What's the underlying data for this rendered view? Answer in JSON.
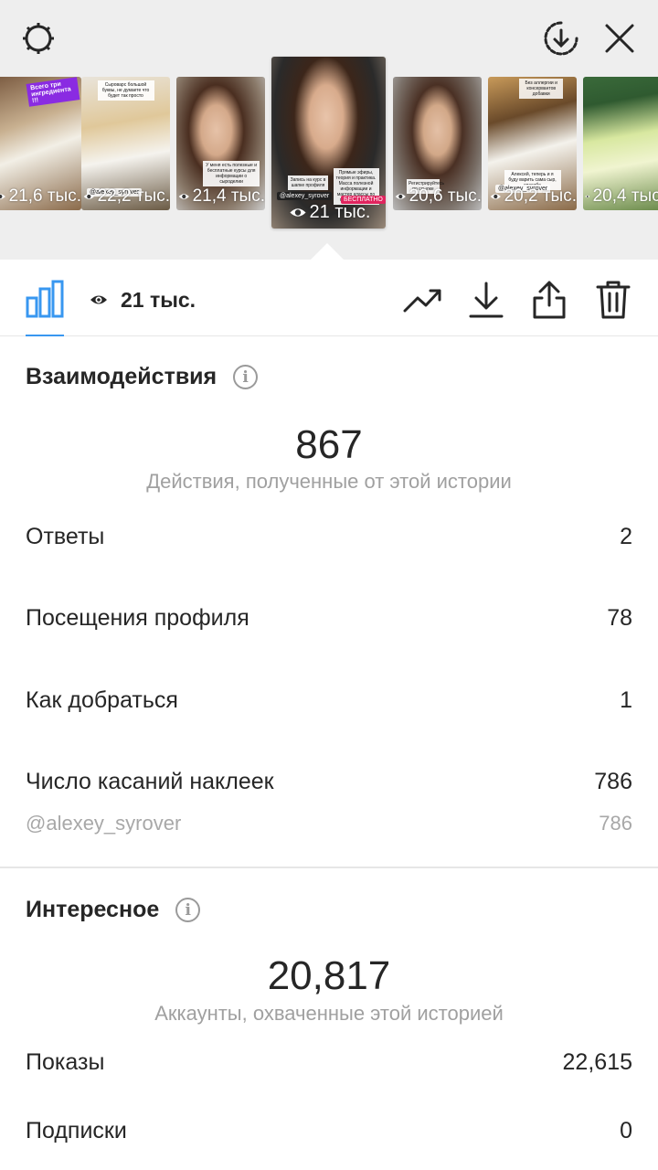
{
  "stories": [
    {
      "views": "21,6 тыс.",
      "caption": "Всего три ингредиента !!!"
    },
    {
      "views": "22,2 тыс.",
      "caption": "Сыроварс большой буквы, не думаете что будет так просто",
      "handle": "@alexey_syrover"
    },
    {
      "views": "21,4 тыс.",
      "caption": "У меня есть полезные и бесплатные курсы для информации о сыроделии"
    },
    {
      "views": "21 тыс.",
      "caption": "Запись на курс в шапке профиля",
      "handle": "@alexey_syrover",
      "caption2": "Прямые эфиры, теория и практика. Масса полезной информации и мастер классы по приготовлению",
      "badge": "БЕСПЛАТНО"
    },
    {
      "views": "20,6 тыс.",
      "caption": "Регистрируйтесь по ссылке"
    },
    {
      "views": "20,2 тыс.",
      "caption": "Без аллергии и консервантов добавки",
      "caption2": "Алексей, теперь и я буду варить сама сыр, спасибо",
      "handle": "@alexey_syrover"
    },
    {
      "views": "20,4 тыс.",
      "caption": ""
    }
  ],
  "toolbar": {
    "views": "21 тыс."
  },
  "interactions": {
    "title": "Взаимодействия",
    "total": "867",
    "total_caption": "Действия, полученные от этой истории",
    "rows": [
      {
        "label": "Ответы",
        "value": "2"
      },
      {
        "label": "Посещения профиля",
        "value": "78"
      },
      {
        "label": "Как добраться",
        "value": "1"
      },
      {
        "label": "Число касаний наклеек",
        "value": "786"
      }
    ],
    "sticker": {
      "label": "@alexey_syrover",
      "value": "786"
    }
  },
  "discovery": {
    "title": "Интересное",
    "total": "20,817",
    "total_caption": "Аккаунты, охваченные этой историей",
    "rows": [
      {
        "label": "Показы",
        "value": "22,615"
      },
      {
        "label": "Подписки",
        "value": "0"
      }
    ]
  },
  "colors": {
    "accent": "#3897f0",
    "text": "#262626",
    "muted": "#a0a0a0"
  }
}
